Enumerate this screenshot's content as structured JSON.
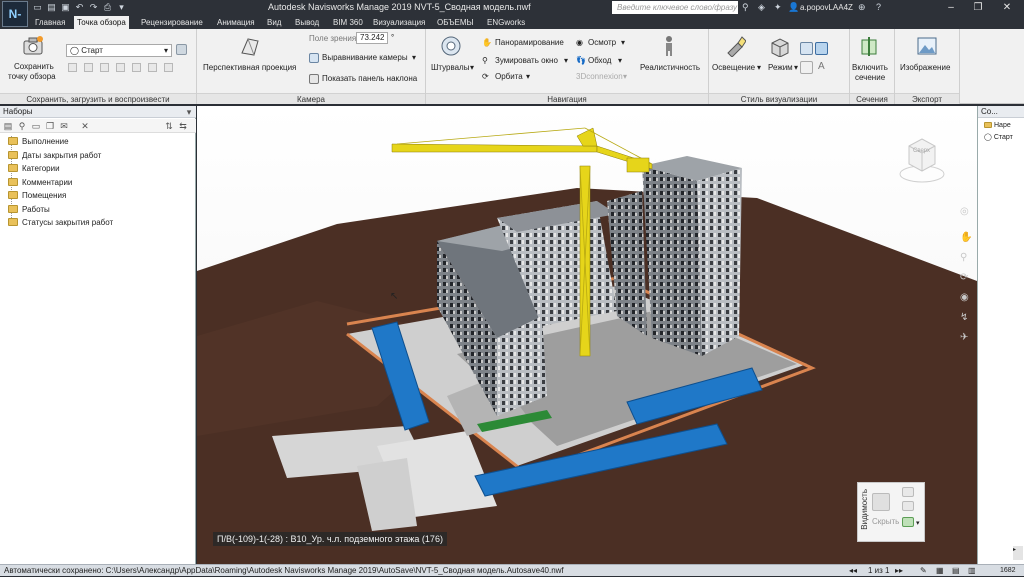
{
  "app": {
    "title": "Autodesk Navisworks Manage 2019    NVT-5_Сводная модель.nwf",
    "logo": "N-",
    "search_placeholder": "Введите ключевое слово/фразу",
    "user": "a.popovLAA4Z"
  },
  "tabs": [
    {
      "label": "Главная"
    },
    {
      "label": "Точка обзора",
      "active": true
    },
    {
      "label": "Рецензирование"
    },
    {
      "label": "Анимация"
    },
    {
      "label": "Вид"
    },
    {
      "label": "Вывод"
    },
    {
      "label": "BIM 360"
    },
    {
      "label": "Визуализация"
    },
    {
      "label": "ОБЪЕМЫ"
    },
    {
      "label": "ENGworks"
    }
  ],
  "ribbon": {
    "save_viewpoint": {
      "line1": "Сохранить",
      "line2": "точку обзора"
    },
    "viewpoint_combo": "Старт",
    "fov_label": "Поле зрения",
    "fov_value": "73.242",
    "perspective": "Перспективная проекция",
    "align_camera": "Выравнивание камеры",
    "show_tilt": "Показать панель наклона",
    "steering": "Штурвалы",
    "pan": "Панорамирование",
    "zoom_window": "Зумировать окно",
    "orbit": "Орбита",
    "look": "Осмотр",
    "walk": "Обход",
    "connexion": "3Dconnexion",
    "realism": "Реалистичность",
    "lighting": "Освещение",
    "mode": "Режим",
    "enable_section": {
      "line1": "Включить",
      "line2": "сечение"
    },
    "image": "Изображение",
    "panels": {
      "save": "Сохранить, загрузить и воспроизвести",
      "camera": "Камера",
      "navigation": "Навигация",
      "visual_style": "Стиль визуализации",
      "sections": "Сечения",
      "export": "Экспорт"
    }
  },
  "left_panel": {
    "title": "Наборы",
    "items": [
      {
        "label": "Выполнение"
      },
      {
        "label": "Даты закрытия работ"
      },
      {
        "label": "Категории"
      },
      {
        "label": "Комментарии"
      },
      {
        "label": "Помещения"
      },
      {
        "label": "Работы"
      },
      {
        "label": "Статусы закрытия работ"
      }
    ]
  },
  "viewport": {
    "hud_label": "П/В(-109)-1(-28) : В10_Ур. ч.л. подземного этажа (176)",
    "visibility_title": "Видимость",
    "visibility_hide": "Скрыть",
    "viewcube_label": "Сверх"
  },
  "right_panel": {
    "title": "Со...",
    "items": [
      {
        "label": "Наре"
      },
      {
        "label": "Старт"
      }
    ]
  },
  "status": {
    "autosave": "Автоматически сохранено: C:\\Users\\Александр\\AppData\\Roaming\\Autodesk Navisworks Manage 2019\\AutoSave\\NVT-5_Сводная модель.Autosave40.nwf",
    "page": "1 из 1",
    "memory": "1682"
  },
  "colors": {
    "ground": "#4a2e22",
    "building": "#8a8f96",
    "crane": "#e6d51a",
    "pool_blue": "#1f78c8",
    "fence": "#d9844f"
  }
}
